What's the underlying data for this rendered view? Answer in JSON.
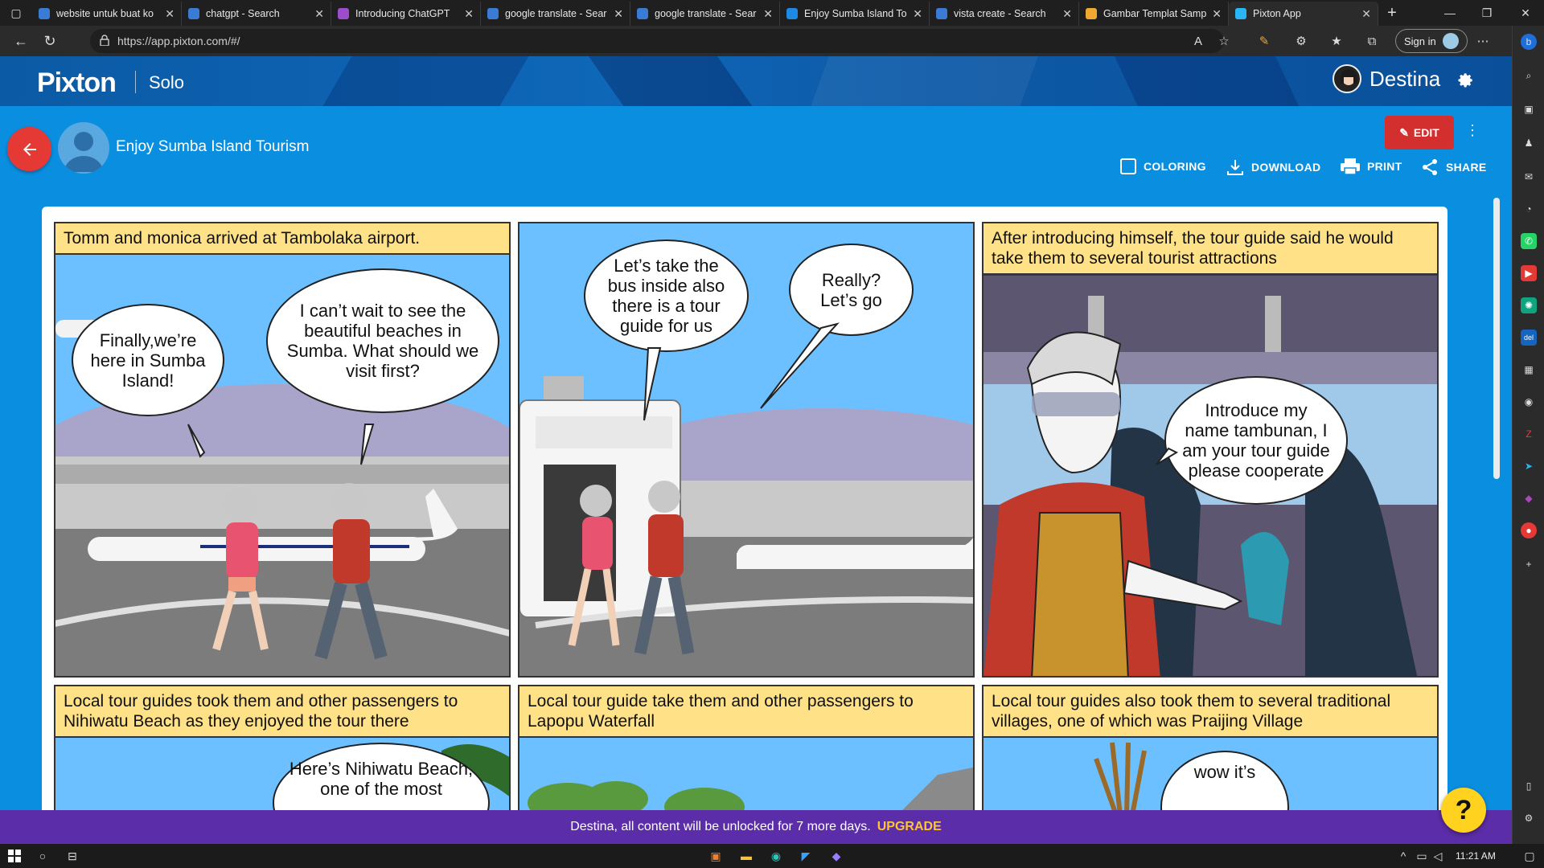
{
  "browser": {
    "tabs": [
      {
        "title": "website untuk buat ko",
        "fav_color": "#3a7bd5"
      },
      {
        "title": "chatgpt - Search",
        "fav_color": "#3a7bd5"
      },
      {
        "title": "Introducing ChatGPT",
        "fav_color": "#9c4dcc"
      },
      {
        "title": "google translate - Sear",
        "fav_color": "#3a7bd5"
      },
      {
        "title": "google translate - Sear",
        "fav_color": "#3a7bd5"
      },
      {
        "title": "Enjoy Sumba Island To",
        "fav_color": "#1e88e5"
      },
      {
        "title": "vista create - Search",
        "fav_color": "#3a7bd5"
      },
      {
        "title": "Gambar Templat Samp",
        "fav_color": "#f0a830"
      },
      {
        "title": "Pixton App",
        "fav_color": "#29b6f6",
        "active": true
      }
    ],
    "url": "https://app.pixton.com/#/",
    "sign_in": "Sign in"
  },
  "app": {
    "logo": "Pixton",
    "plan": "Solo",
    "username": "Destina",
    "comic_title": "Enjoy Sumba Island Tourism",
    "edit_label": "EDIT",
    "actions": {
      "coloring": "COLORING",
      "download": "DOWNLOAD",
      "print": "PRINT",
      "share": "SHARE"
    }
  },
  "panels": [
    {
      "caption": "Tomm and monica arrived at Tambolaka airport.",
      "bubbles": [
        "Finally,we’re here in Sumba Island!",
        "I can’t wait to see the beautiful beaches in Sumba. What should we visit first?"
      ]
    },
    {
      "caption": "",
      "bubbles": [
        "Let’s take the bus inside also there is a tour guide for us",
        "Really? Let’s go"
      ]
    },
    {
      "caption": "After introducing himself, the tour guide said he would take them to several tourist attractions",
      "bubbles": [
        "Introduce my name tambunan, I am your tour guide please cooperate"
      ]
    },
    {
      "caption": "Local tour guides took them and other passengers to Nihiwatu Beach as they enjoyed the tour there",
      "bubbles": [
        "Here’s Nihiwatu Beach, one of the most"
      ]
    },
    {
      "caption": "Local tour guide take them and other passengers to Lapopu Waterfall",
      "bubbles": []
    },
    {
      "caption": "Local tour guides also took them to several traditional villages, one of which was Praijing Village",
      "bubbles": [
        "wow it’s"
      ]
    }
  ],
  "promo": {
    "message": "Destina, all content will be unlocked for 7 more days.",
    "upgrade": "UPGRADE"
  },
  "help_label": "?",
  "taskbar": {
    "time": "11:21 AM"
  }
}
